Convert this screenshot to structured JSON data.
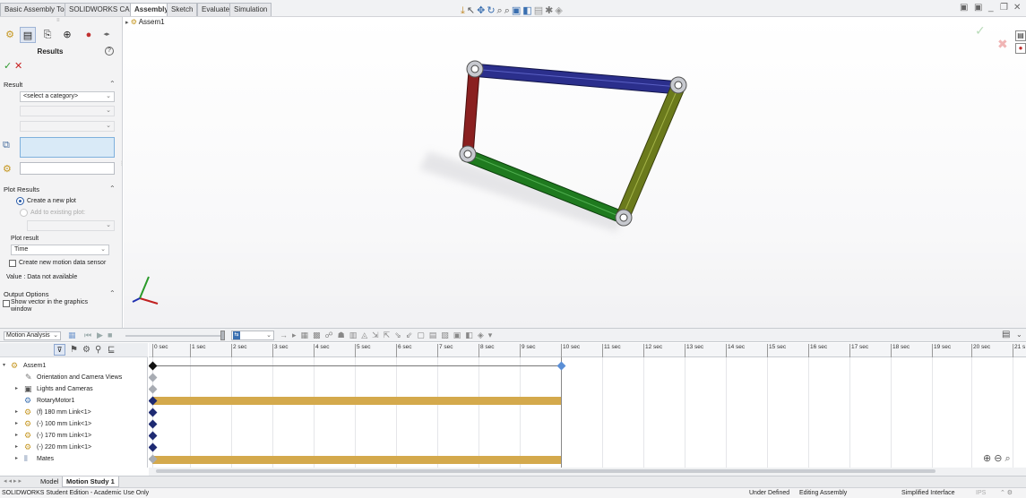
{
  "command_tabs": [
    {
      "label": "Basic Assembly Tools",
      "active": false
    },
    {
      "label": "SOLIDWORKS CAM",
      "active": false
    },
    {
      "label": "Assembly",
      "active": true
    },
    {
      "label": "Sketch",
      "active": false
    },
    {
      "label": "Evaluate",
      "active": false
    },
    {
      "label": "Simulation",
      "active": false
    }
  ],
  "tree": {
    "root_label": "Assem1"
  },
  "property_manager": {
    "title": "Results",
    "help_icon": "?",
    "ok_icon": "✓",
    "cancel_icon": "✕",
    "result_section": "Result",
    "category_select": "<select a category>",
    "plot_results_section": "Plot Results",
    "create_new_plot": "Create a new plot",
    "add_existing_plot": "Add to existing plot:",
    "plot_result_label": "Plot result",
    "plot_result_value": "Time",
    "create_sensor_label": "Create new motion data sensor",
    "value_label": "Value : Data not available",
    "output_section": "Output Options",
    "show_vector_label": "Show vector in the graphics window"
  },
  "motion": {
    "study_type": "Motion Analysis",
    "tree_items": [
      {
        "label": "Assem1",
        "icon": "assembly-icon",
        "expanded": true
      },
      {
        "label": "Orientation and Camera Views",
        "icon": "camera-orientation-icon"
      },
      {
        "label": "Lights and Cameras",
        "icon": "lights-icon"
      },
      {
        "label": "RotaryMotor1",
        "icon": "motor-icon"
      },
      {
        "label": "(f) 180 mm Link<1>",
        "icon": "part-icon"
      },
      {
        "label": "(-) 100 mm Link<1>",
        "icon": "part-icon"
      },
      {
        "label": "(-) 170 mm Link<1>",
        "icon": "part-icon"
      },
      {
        "label": "(-) 220 mm Link<1>",
        "icon": "part-icon"
      },
      {
        "label": "Mates",
        "icon": "mates-icon"
      }
    ],
    "time_ticks": [
      "0 sec",
      "1 sec",
      "2 sec",
      "3 sec",
      "4 sec",
      "5 sec",
      "6 sec",
      "7 sec",
      "8 sec",
      "9 sec",
      "10 sec",
      "11 sec",
      "12 sec",
      "13 sec",
      "14 sec",
      "15 sec",
      "16 sec",
      "17 sec",
      "18 sec",
      "19 sec",
      "20 sec",
      "21 s"
    ],
    "study_end_sec": 10,
    "colors": {
      "bar": "#d4a94c",
      "key_dark": "#1e2a72",
      "key_black": "#111111",
      "key_grey": "#a8acb3",
      "end_key": "#5b8fd6"
    }
  },
  "study_tabs": [
    {
      "label": "Model",
      "active": false
    },
    {
      "label": "Motion Study 1",
      "active": true
    }
  ],
  "status": {
    "left": "SOLIDWORKS Student Edition - Academic Use Only",
    "under_defined": "Under Defined",
    "editing": "Editing Assembly",
    "interface": "Simplified Interface",
    "ips": "IPS"
  },
  "linkage_colors": {
    "top": "#2b2f8c",
    "left": "#8a2020",
    "bottom": "#1f7a1f",
    "right": "#6b7a1c"
  }
}
